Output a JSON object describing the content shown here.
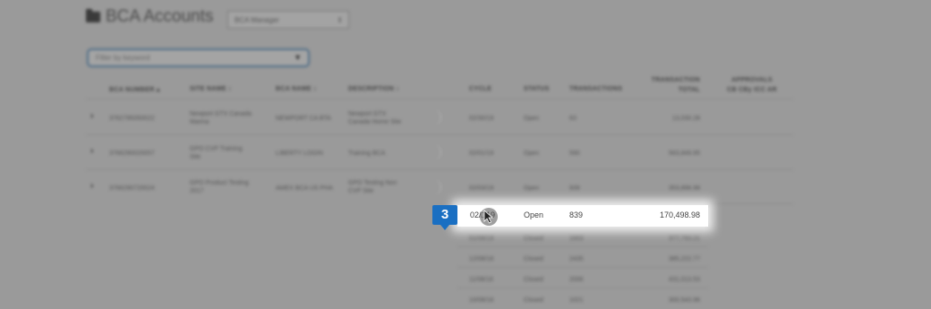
{
  "header": {
    "title": "BCA Accounts",
    "manager_select": "BCA Manager",
    "filter_placeholder": "Filter by keyword"
  },
  "table": {
    "columns": {
      "bca_number": "BCA NUMBER ▴",
      "site_name": "SITE NAME ↕",
      "bca_name": "BCA NAME ↕",
      "description": "DESCRIPTION ↕",
      "cycle": "CYCLE",
      "status": "STATUS",
      "transactions": "TRANSACTIONS",
      "transaction_total_line1": "TRANSACTION",
      "transaction_total_line2": "TOTAL",
      "approvals_line1": "APPROVALS",
      "approvals_line2": "CB  CBy   ICC  AR"
    },
    "accounts": [
      {
        "bca_number": "3762795050022",
        "site_name_1": "Newport GTX Canada",
        "site_name_2": "Marina",
        "bca_name": "NEWPORT CA BTA",
        "desc_1": "Newport GTX",
        "desc_2": "Canada Home Site",
        "cycle": "02/30/19",
        "status": "Open",
        "transactions": "63",
        "total": "13,030.28"
      },
      {
        "bca_number": "3766290020057",
        "site_name_1": "GPO CVP Training",
        "site_name_2": "Site",
        "bca_name": "LIBERTY LOGIN",
        "desc_1": "Training BCA",
        "desc_2": "",
        "cycle": "02/01/19",
        "status": "Open",
        "transactions": "590",
        "total": "563,849.95"
      },
      {
        "bca_number": "3766290720024",
        "site_name_1": "GPO Product Testing",
        "site_name_2": "2017",
        "bca_name": "AMEX BCA US PHA",
        "desc_1": "GPO Testing Non",
        "desc_2": "CVP Site",
        "cycle": "02/03/19",
        "status": "Open",
        "transactions": "939",
        "total": "353,896.98"
      }
    ],
    "highlighted_row": {
      "cycle": "02/□19",
      "status": "Open",
      "transactions": "839",
      "total": "170,498.98"
    },
    "history_rows": [
      {
        "cycle": "01/08/19",
        "status": "Closed",
        "transactions": "1663",
        "total": "377,793.21"
      },
      {
        "cycle": "12/08/18",
        "status": "Closed",
        "transactions": "2435",
        "total": "385,222.77"
      },
      {
        "cycle": "11/08/18",
        "status": "Closed",
        "transactions": "2006",
        "total": "431,013.53"
      },
      {
        "cycle": "10/08/18",
        "status": "Closed",
        "transactions": "1021",
        "total": "300,543.96"
      }
    ]
  },
  "callout": {
    "step_number": "3"
  }
}
